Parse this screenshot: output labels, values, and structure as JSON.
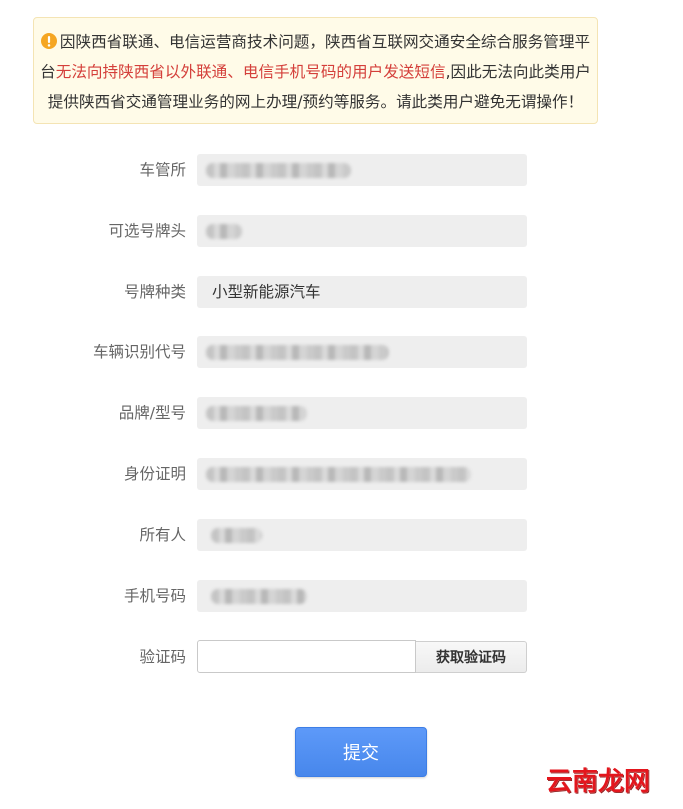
{
  "notice": {
    "icon": "warning-icon",
    "icon_color": "#f5a623",
    "line_1": "因陕西省联通、电信运营商技术问题，陕西省互联网交通安全综合服务管理平",
    "line_2_start": "台",
    "line_2_highlight": "无法向持陕西省以外联通、电信手机号码的用户发送短信",
    "line_2_end": ",因此无法向此类用户",
    "line_3": "提供陕西省交通管理业务的网上办理/预约等服务。请此类用户避免无谓操作！",
    "highlight_color": "#d43f3a"
  },
  "form": {
    "fields": [
      {
        "label": "车管所"
      },
      {
        "label": "可选号牌头"
      },
      {
        "label": "号牌种类",
        "value": "小型新能源汽车"
      },
      {
        "label": "车辆识别代号"
      },
      {
        "label": "品牌/型号"
      },
      {
        "label": "身份证明"
      },
      {
        "label": "所有人"
      },
      {
        "label": "手机号码"
      }
    ],
    "captcha": {
      "label": "验证码",
      "value": "",
      "send_button_label": "获取验证码"
    }
  },
  "submit_button": {
    "label": "提交",
    "color": "#4b8ef8"
  },
  "watermark": {
    "text": "云南龙网"
  }
}
